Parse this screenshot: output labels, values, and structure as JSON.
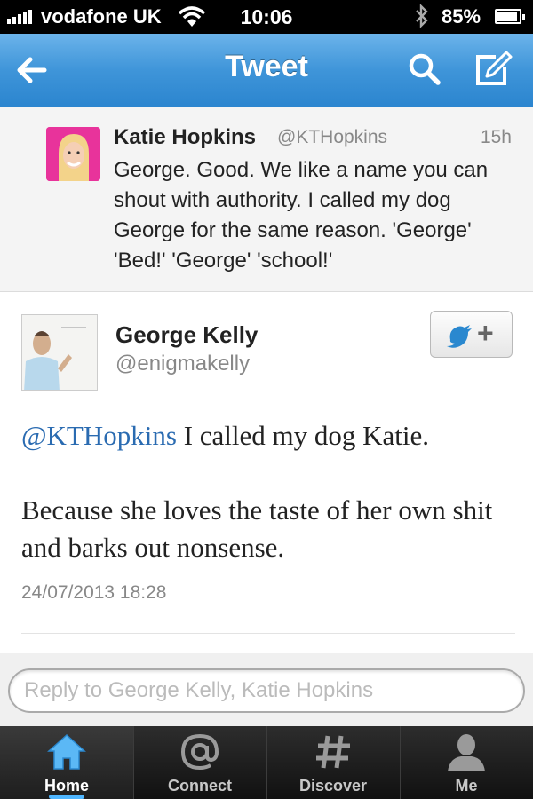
{
  "status_bar": {
    "carrier": "vodafone UK",
    "time": "10:06",
    "battery_percent": "85%",
    "battery_level": 0.85
  },
  "nav": {
    "title": "Tweet",
    "back_icon": "back-arrow-icon",
    "search_icon": "search-icon",
    "compose_icon": "compose-icon"
  },
  "quoted_tweet": {
    "author_name": "Katie Hopkins",
    "author_handle": "@KTHopkins",
    "time": "15h",
    "text": "George. Good. We like a name you can shout with authority. I called my dog George for the same reason. 'George' 'Bed!' 'George' 'school!'"
  },
  "main_tweet": {
    "author_name": "George Kelly",
    "author_handle": "@enigmakelly",
    "mention": "@KTHopkins",
    "text_line1": " I called my dog Katie.",
    "text_line2": "Because she loves the taste of her own shit and barks out nonsense.",
    "date": "24/07/2013 18:28",
    "follow_icon": "twitter-bird-follow-icon",
    "follow_symbol": "+"
  },
  "reply": {
    "placeholder": "Reply to George Kelly, Katie Hopkins"
  },
  "tab_bar": {
    "tabs": [
      {
        "label": "Home",
        "icon": "home-icon",
        "active": true
      },
      {
        "label": "Connect",
        "icon": "at-icon",
        "active": false
      },
      {
        "label": "Discover",
        "icon": "hashtag-icon",
        "active": false
      },
      {
        "label": "Me",
        "icon": "person-icon",
        "active": false
      }
    ]
  },
  "colors": {
    "nav_blue": "#3f95d9",
    "mention_blue": "#2a6bb1",
    "active_glow": "#4fb6ff"
  }
}
